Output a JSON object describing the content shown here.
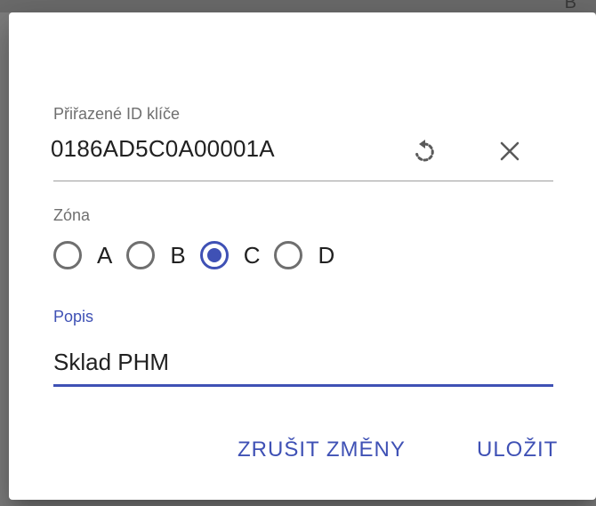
{
  "dialog": {
    "key_id": {
      "label": "Přiřazené ID klíče",
      "value": "0186AD5C0A00001A",
      "regenerate_icon": "regenerate-icon",
      "clear_icon": "close-icon"
    },
    "zone": {
      "label": "Zóna",
      "options": [
        "A",
        "B",
        "C",
        "D"
      ],
      "selected": "C"
    },
    "description": {
      "label": "Popis",
      "value": "Sklad PHM"
    },
    "actions": {
      "discard_label": "ZRUŠIT ZMĚNY",
      "save_label": "ULOŽIT"
    }
  },
  "colors": {
    "accent": "#3f51b5",
    "text": "#212121",
    "muted": "#6f6f6f"
  }
}
